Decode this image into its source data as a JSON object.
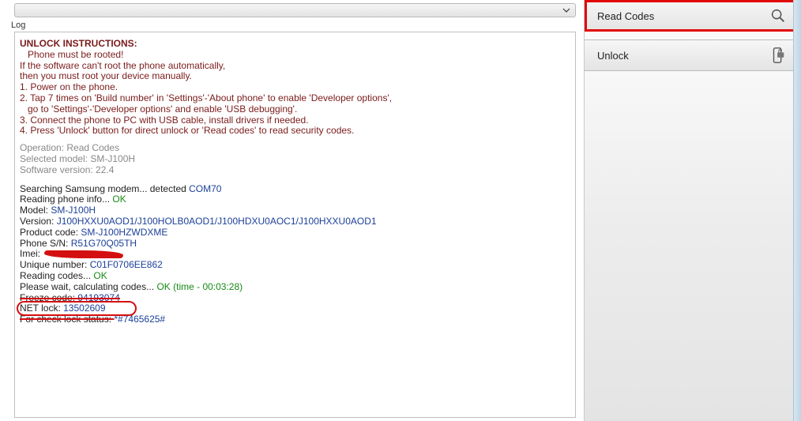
{
  "top_dropdown": {
    "value": "",
    "arrow_name": "chevron-down-icon"
  },
  "log_label": "Log",
  "instructions": {
    "title": "UNLOCK INSTRUCTIONS:",
    "lines": [
      {
        "text": "Phone must be rooted!",
        "indent": true
      },
      {
        "text": "If the software can't root the phone automatically,",
        "indent": false
      },
      {
        "text": "then you must root your device manually.",
        "indent": false
      },
      {
        "text": "1. Power on the phone.",
        "indent": false
      },
      {
        "text": "2. Tap 7 times on 'Build number' in 'Settings'-'About phone' to enable 'Developer options',",
        "indent": false
      },
      {
        "text": "go to 'Settings'-'Developer options' and enable 'USB debugging'.",
        "indent": true
      },
      {
        "text": "3. Connect the phone to PC with USB cable, install drivers if needed.",
        "indent": false
      },
      {
        "text": "4. Press 'Unlock' button for direct unlock or 'Read codes' to read security codes.",
        "indent": false
      }
    ]
  },
  "meta": {
    "operation_lbl": "Operation: ",
    "operation_val": "Read Codes",
    "selected_model_lbl": "Selected model: ",
    "selected_model_val": "SM-J100H",
    "sw_version_lbl": "Software version: ",
    "sw_version_val": "22.4"
  },
  "run": {
    "searching_lbl": "Searching Samsung modem... detected ",
    "com_port": "COM70",
    "reading_info_lbl": "Reading phone info... ",
    "ok": "OK",
    "model_lbl": "Model: ",
    "model_val": "SM-J100H",
    "version_lbl": "Version: ",
    "version_val": "J100HXXU0AOD1/J100HOLB0AOD1/J100HDXU0AOC1/J100HXXU0AOD1",
    "product_lbl": "Product code: ",
    "product_val": "SM-J100HZWDXME",
    "sn_lbl": "Phone S/N: ",
    "sn_val": "R51G70Q05TH",
    "imei_lbl": "Imei: ",
    "unique_lbl": "Unique number: ",
    "unique_val": "C01F0706EE862",
    "reading_codes_lbl": "Reading codes... ",
    "calc_lbl": "Please wait, calculating codes... ",
    "calc_ok": "OK (time - 00:03:28)",
    "freeze_lbl": "Freeze code: ",
    "freeze_val": "94193074",
    "netlock_lbl": "NET lock: ",
    "netlock_val": "13502609",
    "check_lbl": "For check lock status: ",
    "check_val": "*#7465625#"
  },
  "right": {
    "read_codes_label": "Read Codes",
    "unlock_label": "Unlock"
  }
}
